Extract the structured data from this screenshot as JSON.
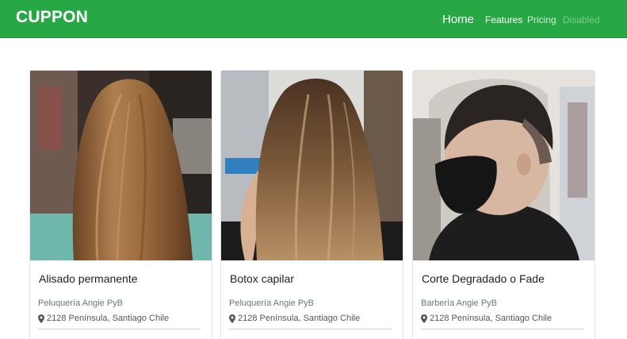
{
  "navbar": {
    "brand": "CUPPON",
    "links": [
      {
        "label": "Home",
        "state": "active"
      },
      {
        "label": "Features",
        "state": "normal"
      },
      {
        "label": "Pricing",
        "state": "normal"
      },
      {
        "label": "Disabled",
        "state": "disabled"
      }
    ],
    "background_color": "#28a745"
  },
  "cards": [
    {
      "image_icon": "straight-long-hair-photo",
      "title": "Alisado permanente",
      "business": "Peluquería Angie PyB",
      "address": "2128 Península, Santiago Chile",
      "address_icon": "map-pin-icon"
    },
    {
      "image_icon": "balayage-hair-photo",
      "title": "Botox capilar",
      "business": "Peluquería Angie PyB",
      "address": "2128 Península, Santiago Chile",
      "address_icon": "map-pin-icon"
    },
    {
      "image_icon": "fade-haircut-photo",
      "title": "Corte Degradado o Fade",
      "business": "Barbería Angie PyB",
      "address": "2128 Península, Santiago Chile",
      "address_icon": "map-pin-icon"
    }
  ]
}
